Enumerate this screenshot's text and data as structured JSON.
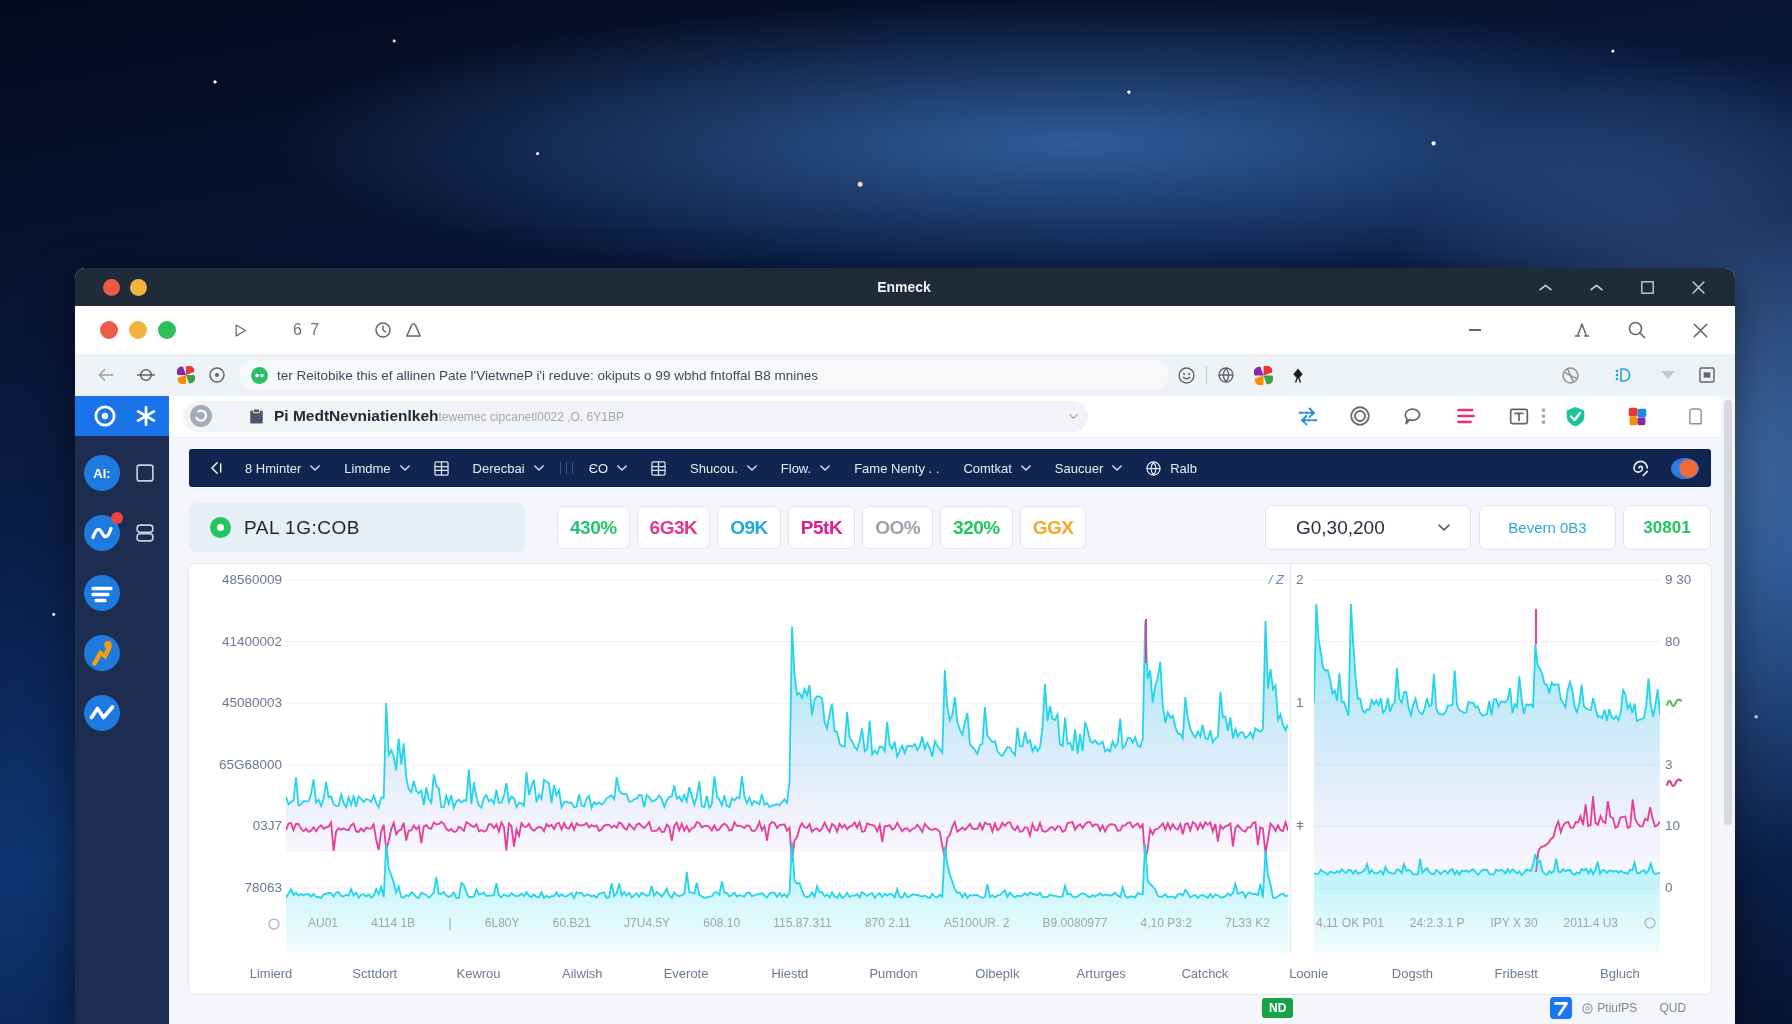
{
  "window": {
    "title": "Enmeck"
  },
  "browser": {
    "tab_count": "6 7",
    "address": "ter Reitobike this ef allinen Pate l'VietwneP i'i reduve: okiputs o 99 wbhd fntoffal B8 mnines",
    "page_field": "**Pi MedtNevniatienlkeh**tewemec cipcanetl0022 ,O. 6Y1BP"
  },
  "sidebar": {
    "items": [
      {
        "kind": "avatar",
        "label": "AI:",
        "badge": false
      },
      {
        "kind": "app",
        "badge": true
      },
      {
        "kind": "chat",
        "badge": false
      },
      {
        "kind": "figure",
        "badge": false
      },
      {
        "kind": "zigzag",
        "badge": false
      }
    ]
  },
  "nav": {
    "items": [
      {
        "kind": "back"
      },
      {
        "kind": "menu",
        "label": "8 Hminter"
      },
      {
        "kind": "menu",
        "label": "Limdme"
      },
      {
        "kind": "grid"
      },
      {
        "kind": "menu",
        "label": "Derecbai"
      },
      {
        "kind": "divider"
      },
      {
        "kind": "menu",
        "label": "ЄO"
      },
      {
        "kind": "grid"
      },
      {
        "kind": "menu",
        "label": "Shucou."
      },
      {
        "kind": "menu",
        "label": "Flow."
      },
      {
        "kind": "plain",
        "label": "Fame Nenty . ."
      },
      {
        "kind": "menu",
        "label": "Comtkat"
      },
      {
        "kind": "menu",
        "label": "Saucuer"
      },
      {
        "kind": "globe",
        "label": "Ralb"
      }
    ]
  },
  "ticker": {
    "symbol": "PAL 1G:COB",
    "chips": [
      {
        "label": "430%",
        "color": "#27c46b"
      },
      {
        "label": "6G3K",
        "color": "#e8358c"
      },
      {
        "label": "O9K",
        "color": "#1ea7e1"
      },
      {
        "label": "P5tK",
        "color": "#e0208a"
      },
      {
        "label": "OO%",
        "color": "#9aa3ad"
      },
      {
        "label": "320%",
        "color": "#22c55e"
      },
      {
        "label": "GGX",
        "color": "#f5a623"
      }
    ],
    "range": "G0,30,200",
    "balance_label": "Bevern 0B3",
    "balance_value": "30801"
  },
  "chart": {
    "left": {
      "y_labels": [
        "48560009",
        "41400002",
        "45080003",
        "65G68000",
        "03J7",
        "78063"
      ],
      "corner_label": "/ Z",
      "bottom_labels": [
        "AU01",
        "4114 1B",
        "|",
        "6L80Y",
        "60.B21",
        "J7U4.5Y",
        "608.10",
        "115.87.311",
        "870 2.11",
        "A5100UR. 2",
        "B9.0080977",
        "4,10 P3:2",
        "7L33 K2"
      ]
    },
    "right": {
      "axis_rows": [
        {
          "left_label": "2",
          "right_label": "9 30"
        },
        {
          "right_label": "80"
        },
        {
          "left_label": "1",
          "marker": {
            "color": "#5cb85c"
          }
        },
        {
          "right_label": "3",
          "marker": {
            "color": "#e2358f"
          }
        },
        {
          "left_label": "ǂ",
          "right_label": "10"
        },
        {
          "right_label": "0"
        }
      ],
      "bottom_labels": [
        "4,11 OK P01",
        "24:2.3.1 P",
        "IPY X 30",
        "2011.4 U3"
      ]
    },
    "categories": [
      "Limierd",
      "Scttdort",
      "Kewrou",
      "Ailwish",
      "Everote",
      "Hiestd",
      "Pumdon",
      "Olbeplk",
      "Arturges",
      "Catchck",
      "Loonie",
      "Dogsth",
      "Fribestt",
      "Bgluch"
    ]
  },
  "footer": {
    "badge": "ND",
    "status": "PtiufPS",
    "code": "QUD"
  }
}
